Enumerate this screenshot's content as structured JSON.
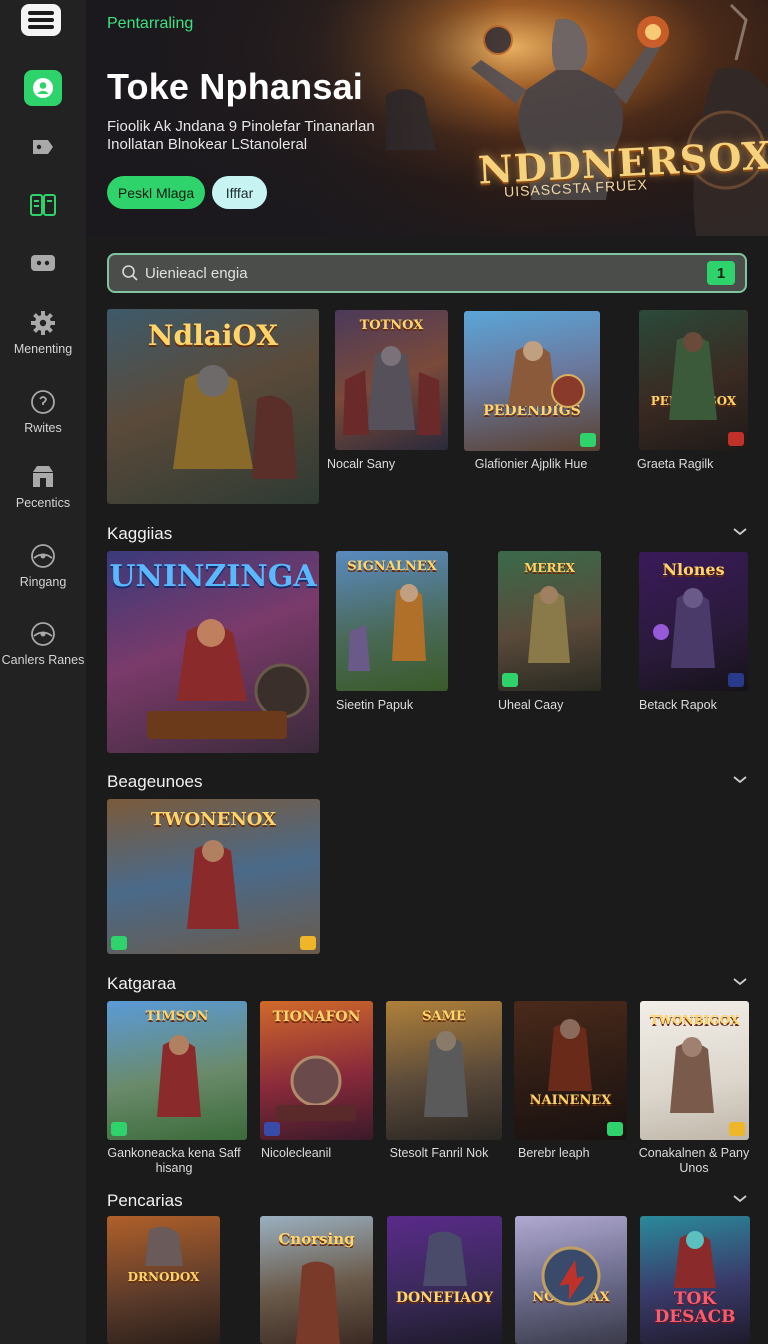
{
  "sidebar": {
    "items": [
      {
        "label": ""
      },
      {
        "label": ""
      },
      {
        "label": ""
      },
      {
        "label": ""
      },
      {
        "label": "Menenting"
      },
      {
        "label": "Rwites"
      },
      {
        "label": "Pecentics"
      },
      {
        "label": "Ringang"
      },
      {
        "label": "Canlers Ranes"
      }
    ]
  },
  "hero": {
    "eyebrow": "Pentarraling",
    "title": "Toke Nphansai",
    "subtitle": "Fioolik  Ak  Jndana  9  Pinolefar  Tinanarlan Inollatan  Blnokear  LStanoleral",
    "primary_button": "Peskl Mlaga",
    "secondary_button": "Ifffar",
    "art_logo": "NDDNERSOX",
    "art_logo_sub": "UISASCSTA FRUEX"
  },
  "search": {
    "placeholder": "Uienieacl engia",
    "badge": "1"
  },
  "sections": [
    {
      "title": "",
      "tiles": [
        {
          "art": "NdlaiOX",
          "caption": ""
        },
        {
          "art": "TOTNOX",
          "caption": "Nocalr Sany"
        },
        {
          "art": "PEDENDIGS",
          "caption": "Glafionier Ajplik Hue"
        },
        {
          "art": "PEDNEFSOX",
          "caption": "Graeta Ragilk"
        }
      ]
    },
    {
      "title": "Kaggiias",
      "tiles": [
        {
          "art": "UNINZINGA",
          "caption": ""
        },
        {
          "art": "SIGNALNEX",
          "caption": "Sieetin Papuk"
        },
        {
          "art": "MEREX",
          "caption": "Uheal Caay"
        },
        {
          "art": "Nlones",
          "caption": "Betack Rapok"
        }
      ]
    },
    {
      "title": "Beageunoes",
      "tiles": [
        {
          "art": "TWONENOX",
          "caption": ""
        }
      ]
    },
    {
      "title": "Katgaraa",
      "tiles": [
        {
          "art": "TIMSON",
          "caption": "Gankoneacka kena Saff hisang"
        },
        {
          "art": "TIONAFON",
          "caption": "Nicolecleanil"
        },
        {
          "art": "SAME",
          "caption": "Stesolt Fanril Nok"
        },
        {
          "art": "NAINENEX",
          "caption": "Berebr leaph"
        },
        {
          "art": "TWONBIGOX",
          "caption": "Conakalnen & Pany Unos"
        }
      ]
    },
    {
      "title": "Pencarias",
      "tiles": [
        {
          "art": "DRNODOX",
          "caption": ""
        },
        {
          "art": "Cnorsing",
          "caption": ""
        },
        {
          "art": "DONEFIAOY",
          "caption": ""
        },
        {
          "art": "NOKONAX",
          "caption": ""
        },
        {
          "art": "TOK DESACB",
          "caption": ""
        }
      ]
    }
  ],
  "colors": {
    "accent": "#2fd36b",
    "background": "#1b1b1c",
    "sidebar": "#222223"
  }
}
